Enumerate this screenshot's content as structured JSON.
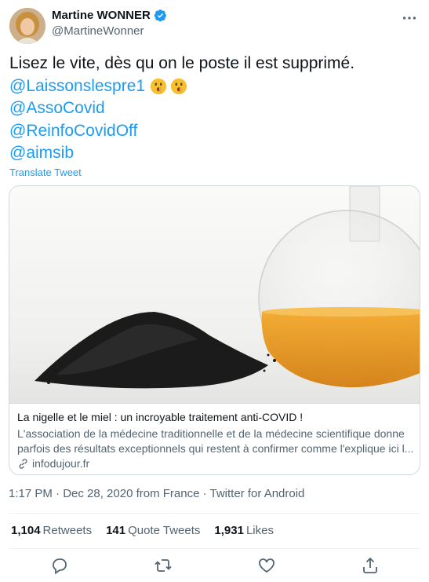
{
  "author": {
    "name": "Martine WONNER",
    "handle": "@MartineWonner",
    "verified": true
  },
  "tweet": {
    "text_line1": "Lisez le vite, dès qu on le poste il est supprimé.",
    "mentions": [
      "@Laissonslespre1",
      "@AssoCovid",
      "@ReinfoCovidOff",
      "@aimsib"
    ],
    "emoji": "shushing-face",
    "translate_label": "Translate Tweet"
  },
  "card": {
    "title": "La nigelle et le miel : un incroyable traitement anti-COVID !",
    "description_line1": "L'association de la médecine traditionnelle et de la médecine scientifique donne",
    "description_line2": "parfois des résultats exceptionnels qui restent à confirmer comme l'explique ici l...",
    "domain": "infodujour.fr",
    "image": "black-seeds-and-honey-flask"
  },
  "meta": {
    "time": "1:17 PM · Dec 28, 2020 from France · ",
    "source": "Twitter for Android"
  },
  "stats": {
    "retweets_count": "1,104",
    "retweets_label": "Retweets",
    "quotes_count": "141",
    "quotes_label": "Quote Tweets",
    "likes_count": "1,931",
    "likes_label": "Likes"
  },
  "actions": [
    "reply-icon",
    "retweet-icon",
    "like-icon",
    "share-icon"
  ],
  "colors": {
    "accent": "#1d9bf0",
    "text": "#0f1419",
    "secondary": "#536471",
    "border": "#cfd9de"
  }
}
